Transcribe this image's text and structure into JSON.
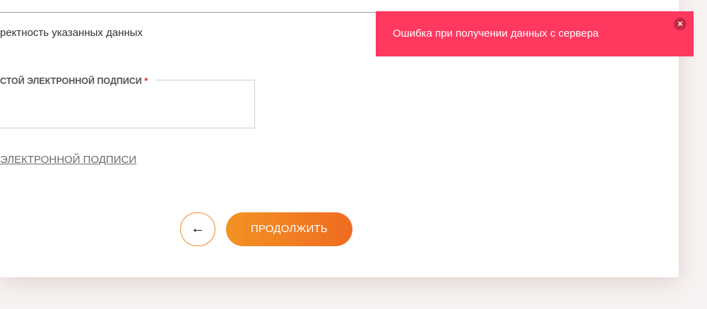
{
  "form": {
    "hint_text": "ректность указанных данных",
    "signature_label": "СТОЙ ЭЛЕКТРОННОЙ ПОДПИСИ",
    "required_mark": "*",
    "signature_value": "",
    "signature_link": "ЭЛЕКТРОННОЙ ПОДПИСИ",
    "back_button_glyph": "←",
    "continue_label": "ПРОДОЛЖИТЬ"
  },
  "toast": {
    "message": "Ошибка при получении данных с сервера",
    "close_glyph": "×"
  },
  "colors": {
    "accent_orange_start": "#f39222",
    "accent_orange_end": "#ef6c22",
    "error_toast": "#ff3860",
    "error_close": "#c92744"
  },
  "icons": {
    "back": "arrow-left-icon",
    "close": "close-icon"
  }
}
